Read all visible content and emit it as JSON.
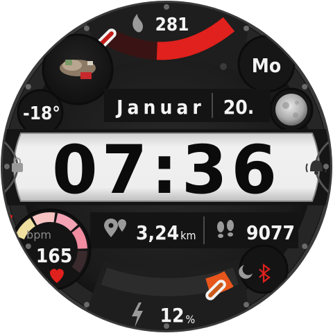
{
  "calories": {
    "value": "281",
    "progress": 0.62
  },
  "weekday": "Mo",
  "temperature": "-18°",
  "date": {
    "month": "Januar",
    "day": "20."
  },
  "time": "07:36",
  "heart": {
    "label": "bpm",
    "value": "165",
    "zones": 5,
    "zone_level": 4
  },
  "distance": {
    "value": "3,24",
    "unit": "km"
  },
  "steps": "9077",
  "battery": {
    "value": "12",
    "unit": "%",
    "progress": 0.12
  },
  "colors": {
    "accent_red": "#e0211d",
    "battery_orange": "#e8561b",
    "band_white": "#e9e9e9",
    "heart_pink": "#f4a3b4"
  },
  "icons": [
    "flame-icon",
    "lock-icon",
    "alarm-icon",
    "location-icon",
    "footsteps-icon",
    "heart-icon",
    "bolt-icon",
    "moon-icon",
    "bluetooth-icon",
    "moon-phase-icon",
    "weather-icon"
  ]
}
